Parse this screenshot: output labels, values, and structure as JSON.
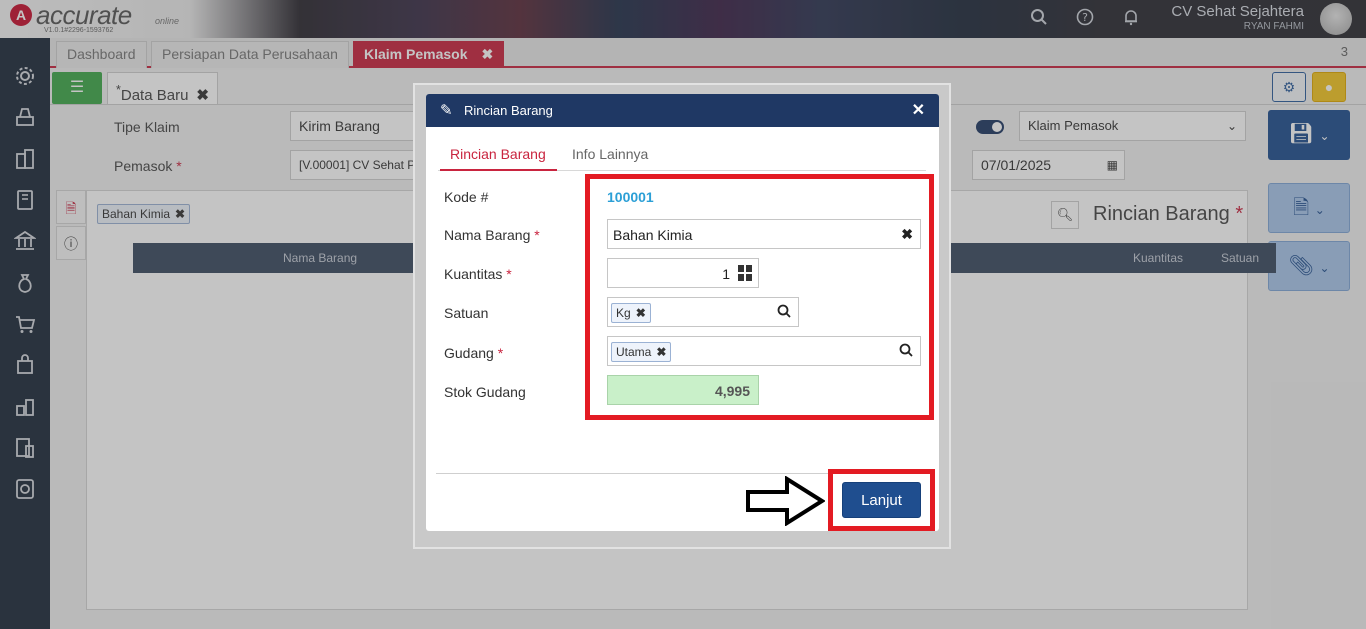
{
  "app": {
    "brand": "accurate",
    "brand_sub": "online",
    "version": "V1.0.1#2296-1593762",
    "company_name": "CV Sehat Sejahtera",
    "user_name": "RYAN FAHMI"
  },
  "tabs": [
    {
      "label": "Dashboard"
    },
    {
      "label": "Persiapan Data Perusahaan"
    },
    {
      "label": "Klaim Pemasok"
    }
  ],
  "tab_count": "3",
  "subtab": {
    "label": "Data Baru",
    "marker": "*"
  },
  "form": {
    "tipe_klaim_label": "Tipe Klaim",
    "tipe_klaim_value": "Kirim Barang",
    "pemasok_label": "Pemasok",
    "pemasok_value": "[V.00001] CV Sehat P",
    "klaim_type_select": "Klaim Pemasok",
    "tanggal_value": "07/01/2025"
  },
  "detail": {
    "search_chip": "Bahan Kimia",
    "section_title": "Rincian Barang",
    "columns": [
      "Nama Barang",
      "Kuantitas",
      "Satuan"
    ]
  },
  "modal": {
    "title": "Rincian Barang",
    "tabs": [
      "Rincian Barang",
      "Info Lainnya"
    ],
    "fields": {
      "kode_label": "Kode #",
      "kode_value": "100001",
      "nama_label": "Nama Barang",
      "nama_value": "Bahan Kimia",
      "kuantitas_label": "Kuantitas",
      "kuantitas_value": "1",
      "satuan_label": "Satuan",
      "satuan_value": "Kg",
      "gudang_label": "Gudang",
      "gudang_value": "Utama",
      "stok_label": "Stok Gudang",
      "stok_value": "4,995"
    },
    "button_label": "Lanjut"
  },
  "colors": {
    "accent_red": "#c9243f",
    "highlight_red": "#e31b23",
    "header_navy": "#1f3864",
    "button_blue": "#1f4e8f",
    "kode_blue": "#2b9fd6",
    "stok_green": "#c9f0c9"
  },
  "icons": [
    "search-icon",
    "help-icon",
    "bell-icon",
    "gear-icon",
    "pencil-icon",
    "close-icon",
    "calculator-icon",
    "save-icon",
    "document-icon",
    "paperclip-icon",
    "arrow-right-icon",
    "calendar-icon",
    "chevron-down-icon"
  ]
}
